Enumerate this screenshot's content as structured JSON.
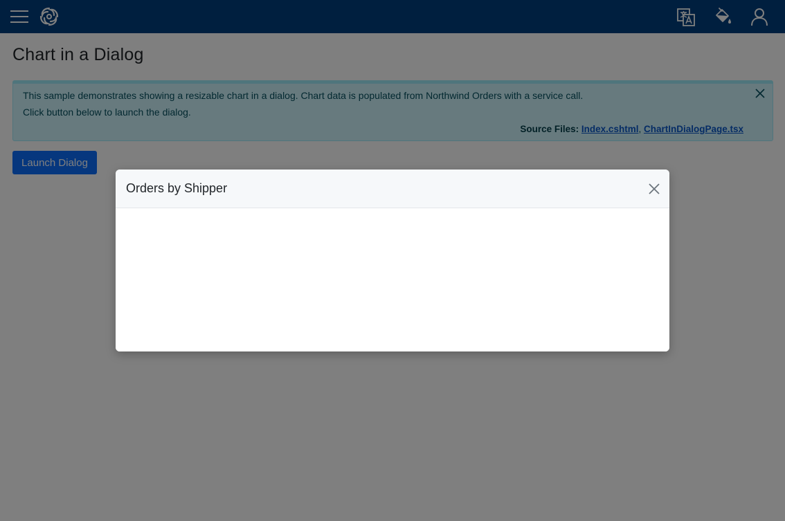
{
  "header": {
    "menu_icon": "hamburger-icon",
    "logo_icon": "swirl-logo-icon",
    "language_icon": "translate-icon",
    "theme_icon": "paint-bucket-icon",
    "user_icon": "user-icon",
    "background_color": "#003e7e"
  },
  "page": {
    "title": "Chart in a Dialog"
  },
  "alert": {
    "line1": "This sample demonstrates showing a resizable chart in a dialog. Chart data is populated from Northwind Orders with a service call.",
    "line2": "Click button below to launch the dialog.",
    "sources_label": "Source Files: ",
    "source_file_1": "Index.cshtml",
    "separator": ", ",
    "source_file_2": "ChartInDialogPage.tsx",
    "close_icon": "close-icon"
  },
  "actions": {
    "launch_label": "Launch Dialog"
  },
  "dialog": {
    "title": "Orders by Shipper",
    "close_icon": "close-icon"
  }
}
